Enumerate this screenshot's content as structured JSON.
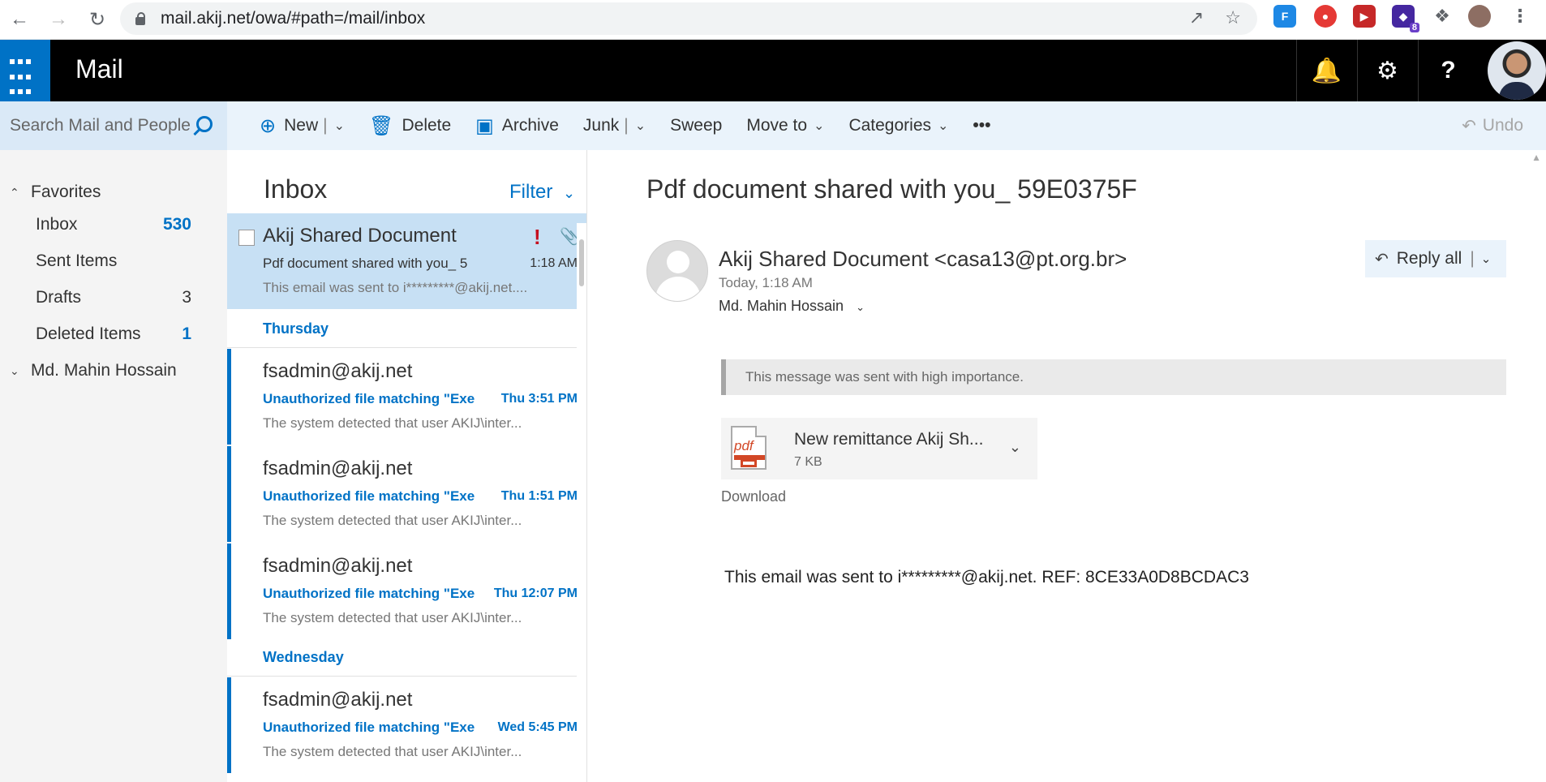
{
  "browser": {
    "url": "mail.akij.net/owa/#path=/mail/inbox",
    "ext_badge": "8"
  },
  "header": {
    "app_title": "Mail",
    "icons": [
      "bell-icon",
      "gear-icon",
      "help-icon"
    ]
  },
  "search": {
    "placeholder": "Search Mail and People"
  },
  "toolbar": {
    "new_label": "New",
    "delete_label": "Delete",
    "archive_label": "Archive",
    "junk_label": "Junk",
    "sweep_label": "Sweep",
    "move_label": "Move to",
    "categories_label": "Categories",
    "more_label": "•••",
    "undo_label": "Undo"
  },
  "nav": {
    "favorites_label": "Favorites",
    "folders": [
      {
        "label": "Inbox",
        "count": "530"
      },
      {
        "label": "Sent Items",
        "count": ""
      },
      {
        "label": "Drafts",
        "count": "3"
      },
      {
        "label": "Deleted Items",
        "count": "1"
      }
    ],
    "account_label": "Md. Mahin Hossain"
  },
  "list": {
    "title": "Inbox",
    "filter_label": "Filter",
    "selected": {
      "sender": "Akij Shared Document",
      "subject": "Pdf document shared with you_ 5",
      "time": "1:18 AM",
      "preview": "This email was sent to i*********@akij.net...."
    },
    "groups": [
      {
        "label": "Thursday"
      },
      {
        "label": "Wednesday"
      }
    ],
    "items": [
      {
        "sender": "fsadmin@akij.net",
        "subject": "Unauthorized file matching \"Exe",
        "time": "Thu 3:51 PM",
        "preview": "The system detected that user AKIJ\\inter..."
      },
      {
        "sender": "fsadmin@akij.net",
        "subject": "Unauthorized file matching \"Exe",
        "time": "Thu 1:51 PM",
        "preview": "The system detected that user AKIJ\\inter..."
      },
      {
        "sender": "fsadmin@akij.net",
        "subject": "Unauthorized file matching \"Exe",
        "time": "Thu 12:07 PM",
        "preview": "The system detected that user AKIJ\\inter..."
      },
      {
        "sender": "fsadmin@akij.net",
        "subject": "Unauthorized file matching \"Exe",
        "time": "Wed 5:45 PM",
        "preview": "The system detected that user AKIJ\\inter..."
      }
    ]
  },
  "message": {
    "subject": "Pdf document shared with you_ 59E0375F",
    "from": "Akij Shared Document <casa13@pt.org.br>",
    "date": "Today, 1:18 AM",
    "to": "Md. Mahin Hossain",
    "reply_all_label": "Reply all",
    "importance_notice": "This message was sent with high importance.",
    "attachment": {
      "name": "New remittance Akij Sh...",
      "size": "7 KB",
      "icon_label": "pdf"
    },
    "download_label": "Download",
    "body": "This email was sent to i*********@akij.net. REF: 8CE33A0D8BCDAC3"
  },
  "colors": {
    "accent": "#0072c6",
    "header_bg": "#000000",
    "toolbar_bg": "#eaf3fb",
    "selected_bg": "#c7e0f4",
    "importance": "#c50f1f"
  }
}
